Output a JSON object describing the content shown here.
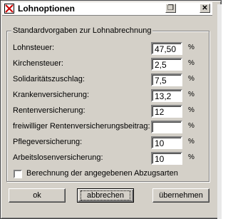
{
  "window": {
    "title": "Lohnoptionen",
    "restore_glyph": "❐",
    "close_glyph": "✕"
  },
  "group": {
    "title": "Standardvorgaben zur Lohnabrechnung"
  },
  "rows": [
    {
      "label": "Lohnsteuer:",
      "value": "47,50",
      "unit": "%"
    },
    {
      "label": "Kirchensteuer:",
      "value": "2,5",
      "unit": "%"
    },
    {
      "label": "Solidaritätszuschlag:",
      "value": "7,5",
      "unit": "%"
    },
    {
      "label": "Krankenversicherung:",
      "value": "13,2",
      "unit": "%"
    },
    {
      "label": "Rentenversicherung:",
      "value": "12",
      "unit": "%"
    },
    {
      "label": "freiwilliger Rentenversicherungsbeitrag:",
      "value": "",
      "unit": "%"
    },
    {
      "label": "Pflegeversicherung:",
      "value": "10",
      "unit": "%"
    },
    {
      "label": "Arbeitslosenversicherung:",
      "value": "10",
      "unit": "%"
    }
  ],
  "checkbox": {
    "label": "Berechnung der angegebenen Abzugsarten",
    "checked": false
  },
  "buttons": {
    "ok": "ok",
    "cancel": "abbrechen",
    "apply": "übernehmen"
  },
  "icons": [
    "app-icon",
    "restore-icon",
    "close-icon"
  ]
}
